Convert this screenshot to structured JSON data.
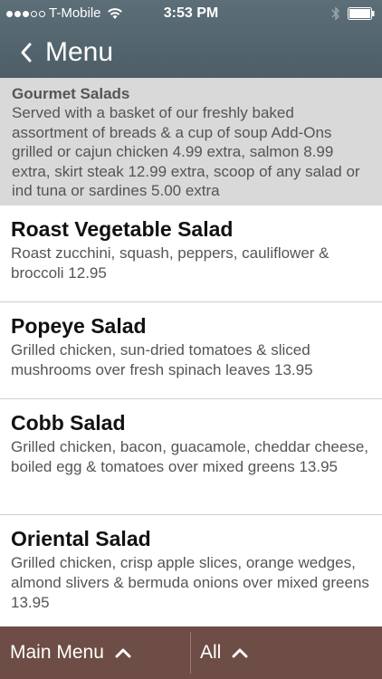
{
  "status_bar": {
    "carrier": "T-Mobile",
    "time": "3:53 PM"
  },
  "nav": {
    "back_icon": "chevron-left-icon",
    "title": "Menu"
  },
  "section": {
    "title": "Gourmet Salads",
    "description": "Served with a basket of our freshly baked assortment of breads & a cup of soup Add-Ons grilled or cajun chicken 4.99 extra, salmon 8.99 extra, skirt steak 12.99 extra, scoop of any salad or ind tuna or sardines 5.00 extra"
  },
  "items": [
    {
      "name": "Roast Vegetable Salad",
      "description": "Roast zucchini, squash, peppers, cauliflower & broccoli 12.95"
    },
    {
      "name": "Popeye Salad",
      "description": "Grilled chicken, sun-dried tomatoes & sliced mushrooms over fresh spinach leaves 13.95"
    },
    {
      "name": "Cobb Salad",
      "description": "Grilled chicken, bacon, guacamole, cheddar cheese, boiled egg & tomatoes over mixed greens 13.95"
    },
    {
      "name": "Oriental Salad",
      "description": "Grilled chicken, crisp apple slices, orange wedges, almond slivers & bermuda onions over mixed greens 13.95"
    }
  ],
  "bottom_bar": {
    "main_menu_label": "Main Menu",
    "all_label": "All"
  },
  "colors": {
    "header": "#55666f",
    "section_bg": "#d9d9d9",
    "bottom_bar": "#6d4d45"
  }
}
